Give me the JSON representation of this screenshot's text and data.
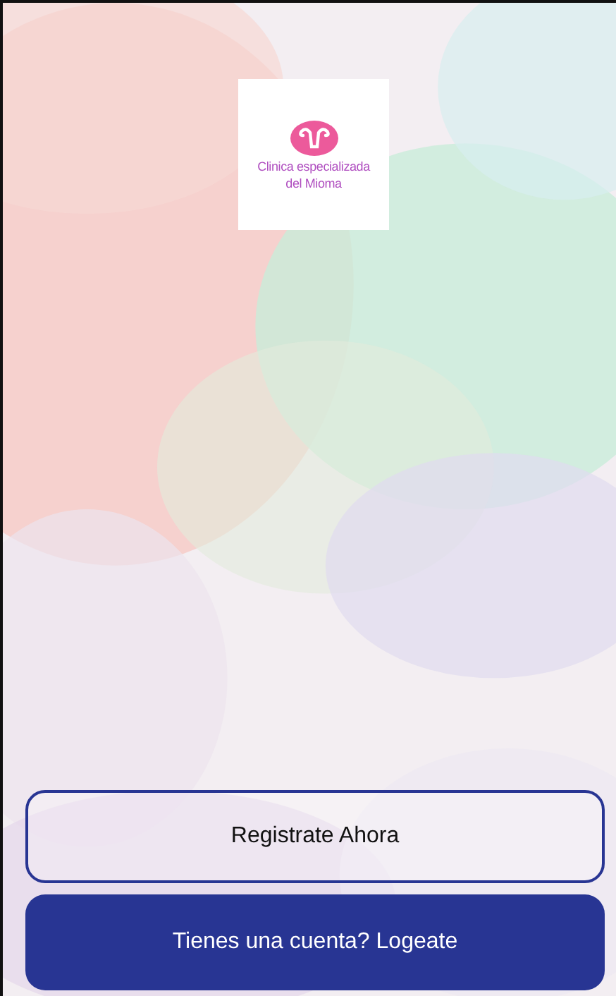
{
  "logo": {
    "lines": [
      "Clinica especializada",
      "del Mioma"
    ]
  },
  "buttons": [
    {
      "label": "Registrate Ahora",
      "kind": "outline"
    },
    {
      "label": "Tienes una cuenta? Logeate",
      "kind": "filled"
    }
  ]
}
